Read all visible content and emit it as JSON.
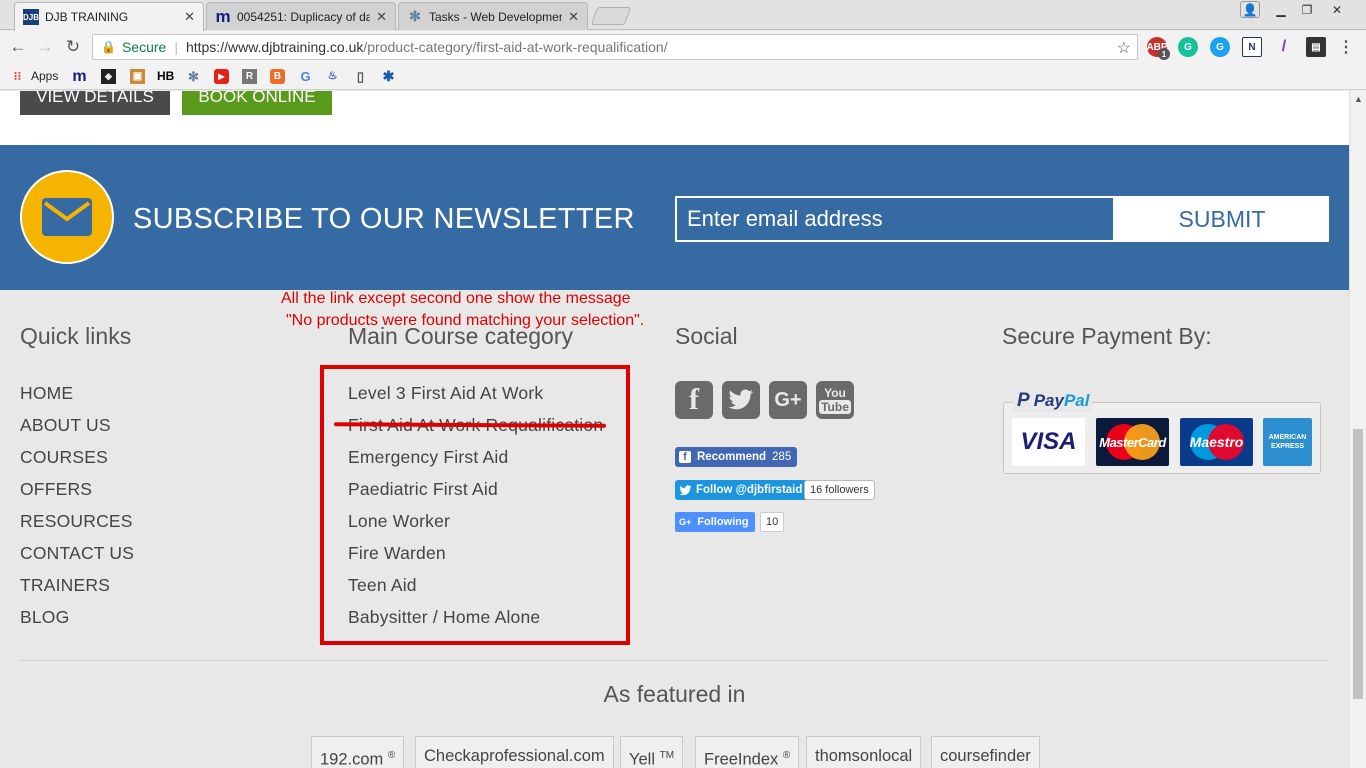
{
  "browser": {
    "tabs": [
      {
        "title": "DJB TRAINING",
        "active": true,
        "favicon": "djb-favicon"
      },
      {
        "title": "0054251: Duplicacy of da",
        "active": false,
        "favicon": "mantis-favicon"
      },
      {
        "title": "Tasks - Web Developmen",
        "active": false,
        "favicon": "tasks-favicon"
      }
    ],
    "secure_label": "Secure",
    "url_host": "https://www.djbtraining.co.uk",
    "url_path": "/product-category/first-aid-at-work-requalification/",
    "extension_badge": "1",
    "bookmarks": {
      "apps": "Apps"
    }
  },
  "page": {
    "buttons": {
      "view_details": "VIEW DETAILS",
      "book_online": "BOOK ONLINE"
    },
    "newsletter": {
      "title": "SUBSCRIBE TO OUR NEWSLETTER",
      "email_placeholder": "Enter email address",
      "submit": "SUBMIT"
    },
    "annotation": {
      "line1": "All the link except second one show the message",
      "line2": "\"No products were found matching your selection\"."
    },
    "quick_links": {
      "heading": "Quick links",
      "items": [
        "HOME",
        "ABOUT US",
        "COURSES",
        "OFFERS",
        "RESOURCES",
        "CONTACT US",
        "TRAINERS",
        "BLOG"
      ]
    },
    "main_category": {
      "heading": "Main Course category",
      "items": [
        "Level 3 First Aid At Work",
        "First Aid At Work Requalification",
        "Emergency First Aid",
        "Paediatric First Aid",
        "Lone Worker",
        "Fire Warden",
        "Teen Aid",
        "Babysitter / Home Alone"
      ]
    },
    "social": {
      "heading": "Social",
      "icons": [
        "facebook-icon",
        "twitter-icon",
        "google-plus-icon",
        "youtube-icon"
      ],
      "youtube_text_top": "You",
      "youtube_text_bottom": "Tube",
      "fb_recommend": "Recommend",
      "fb_count": "285",
      "twitter_follow": "Follow @djbfirstaid",
      "twitter_followers": "16 followers",
      "gplus_following": "Following",
      "gplus_count": "10"
    },
    "payment": {
      "heading": "Secure Payment By:",
      "paypal_a": "Pay",
      "paypal_b": "Pal",
      "cards": {
        "visa": "VISA",
        "mastercard": "MasterCard",
        "maestro": "Maestro",
        "amex_top": "AMERICAN",
        "amex_bottom": "EXPRESS"
      }
    },
    "featured": {
      "heading": "As featured in",
      "items": [
        {
          "name": "192.com",
          "mark": "®"
        },
        {
          "name": "Checkaprofessional.com",
          "mark": ""
        },
        {
          "name": "Yell",
          "mark": "TM"
        },
        {
          "name": "FreeIndex",
          "mark": "®"
        },
        {
          "name": "thomsonlocal",
          "mark": ""
        },
        {
          "name": "coursefinder",
          "mark": ""
        }
      ]
    },
    "colors": {
      "newsletter_bg": "#366aa3",
      "annotation_red": "#e00000",
      "book_green": "#5a9a1a",
      "mail_yellow": "#f4b400"
    }
  }
}
